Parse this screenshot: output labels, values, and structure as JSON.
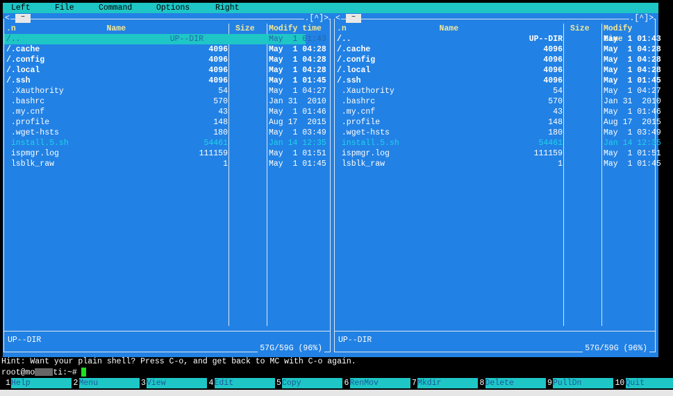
{
  "menu": [
    "Left",
    "File",
    "Command",
    "Options",
    "Right"
  ],
  "panel_title": "~",
  "panel_corner": ".[^]>",
  "panel_left_arrow": "<",
  "columns": {
    "name_sort": ".n",
    "name": "Name",
    "size": "Size",
    "mtime": "Modify time"
  },
  "files": [
    {
      "name": "/..",
      "size": "UP--DIR",
      "date": "May  1 01:43",
      "type": "sel"
    },
    {
      "name": "/.cache",
      "size": "4096",
      "date": "May  1 04:28",
      "type": "dir"
    },
    {
      "name": "/.config",
      "size": "4096",
      "date": "May  1 04:28",
      "type": "dir"
    },
    {
      "name": "/.local",
      "size": "4096",
      "date": "May  1 04:28",
      "type": "dir"
    },
    {
      "name": "/.ssh",
      "size": "4096",
      "date": "May  1 01:45",
      "type": "dir"
    },
    {
      "name": " .Xauthority",
      "size": "54",
      "date": "May  1 04:27",
      "type": "file"
    },
    {
      "name": " .bashrc",
      "size": "570",
      "date": "Jan 31  2010",
      "type": "file"
    },
    {
      "name": " .my.cnf",
      "size": "43",
      "date": "May  1 01:46",
      "type": "file"
    },
    {
      "name": " .profile",
      "size": "148",
      "date": "Aug 17  2015",
      "type": "file"
    },
    {
      "name": " .wget-hsts",
      "size": "180",
      "date": "May  1 03:49",
      "type": "file"
    },
    {
      "name": " install.5.sh",
      "size": "54461",
      "date": "Jan 14 12:35",
      "type": "exe"
    },
    {
      "name": " ispmgr.log",
      "size": "111159",
      "date": "May  1 01:51",
      "type": "file"
    },
    {
      "name": " lsblk_raw",
      "size": "1",
      "date": "May  1 01:45",
      "type": "file"
    }
  ],
  "panel_status": "UP--DIR",
  "disk_free": "57G/59G (96%)",
  "hint": "Hint: Want your plain shell? Press C-o, and get back to MC with C-o again.",
  "prompt": {
    "before": "root@mo",
    "after": "ti:~#"
  },
  "fkeys": [
    {
      "num": "1",
      "label": "Help"
    },
    {
      "num": "2",
      "label": "Menu"
    },
    {
      "num": "3",
      "label": "View"
    },
    {
      "num": "4",
      "label": "Edit"
    },
    {
      "num": "5",
      "label": "Copy"
    },
    {
      "num": "6",
      "label": "RenMov"
    },
    {
      "num": "7",
      "label": "Mkdir"
    },
    {
      "num": "8",
      "label": "Delete"
    },
    {
      "num": "9",
      "label": "PullDn"
    },
    {
      "num": "10",
      "label": "Quit"
    }
  ],
  "colors": {
    "panel": "#2281e4",
    "cyan": "#1fc6c6",
    "executable": "#1ed4e8",
    "cursor": "#1ee01e"
  }
}
